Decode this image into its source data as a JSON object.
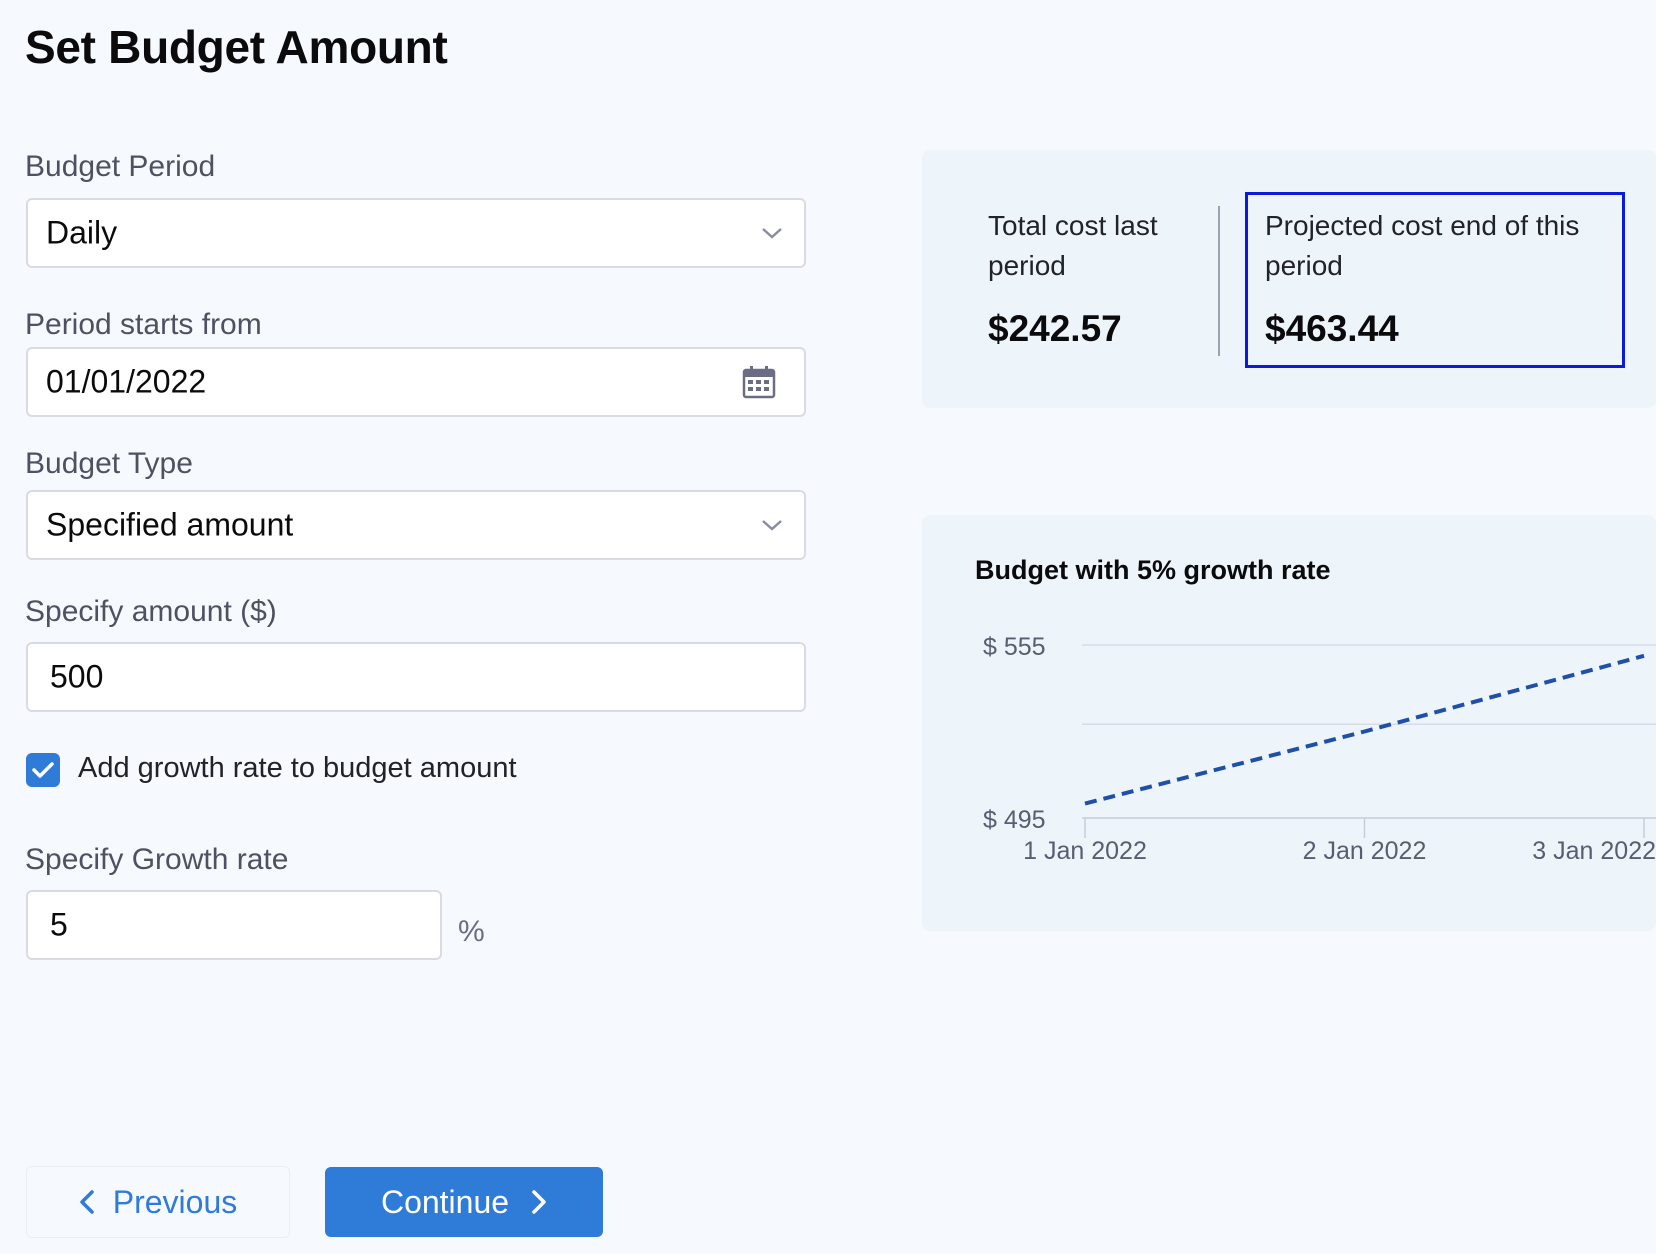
{
  "page": {
    "title": "Set Budget Amount"
  },
  "form": {
    "budget_period": {
      "label": "Budget Period",
      "value": "Daily"
    },
    "period_start": {
      "label": "Period starts from",
      "value": "01/01/2022"
    },
    "budget_type": {
      "label": "Budget Type",
      "value": "Specified amount"
    },
    "amount": {
      "label": "Specify amount ($)",
      "value": "500"
    },
    "growth_checkbox": {
      "label": "Add growth rate to budget amount",
      "checked": true
    },
    "growth_rate": {
      "label": "Specify Growth rate",
      "value": "5",
      "unit": "%"
    }
  },
  "buttons": {
    "previous": "Previous",
    "continue": "Continue"
  },
  "costs": {
    "last_period": {
      "label": "Total cost last period",
      "value": "$242.57"
    },
    "projected": {
      "label": "Projected cost end of this period",
      "value": "$463.44"
    }
  },
  "colors": {
    "accent": "#2f7bd8",
    "highlight": "#0a19de",
    "line": "#1f4fa8",
    "panel": "#eef5fa"
  },
  "chart_data": {
    "type": "line",
    "title": "Budget with 5% growth rate",
    "x": [
      "1 Jan 2022",
      "2 Jan 2022",
      "3 Jan 2022"
    ],
    "series": [
      {
        "values": [
          500,
          525,
          551.25
        ]
      }
    ],
    "y_ticks": [
      "$ 555",
      "$ 495"
    ],
    "ylim": [
      495,
      555
    ],
    "line_style": "dashed",
    "grid": true
  }
}
